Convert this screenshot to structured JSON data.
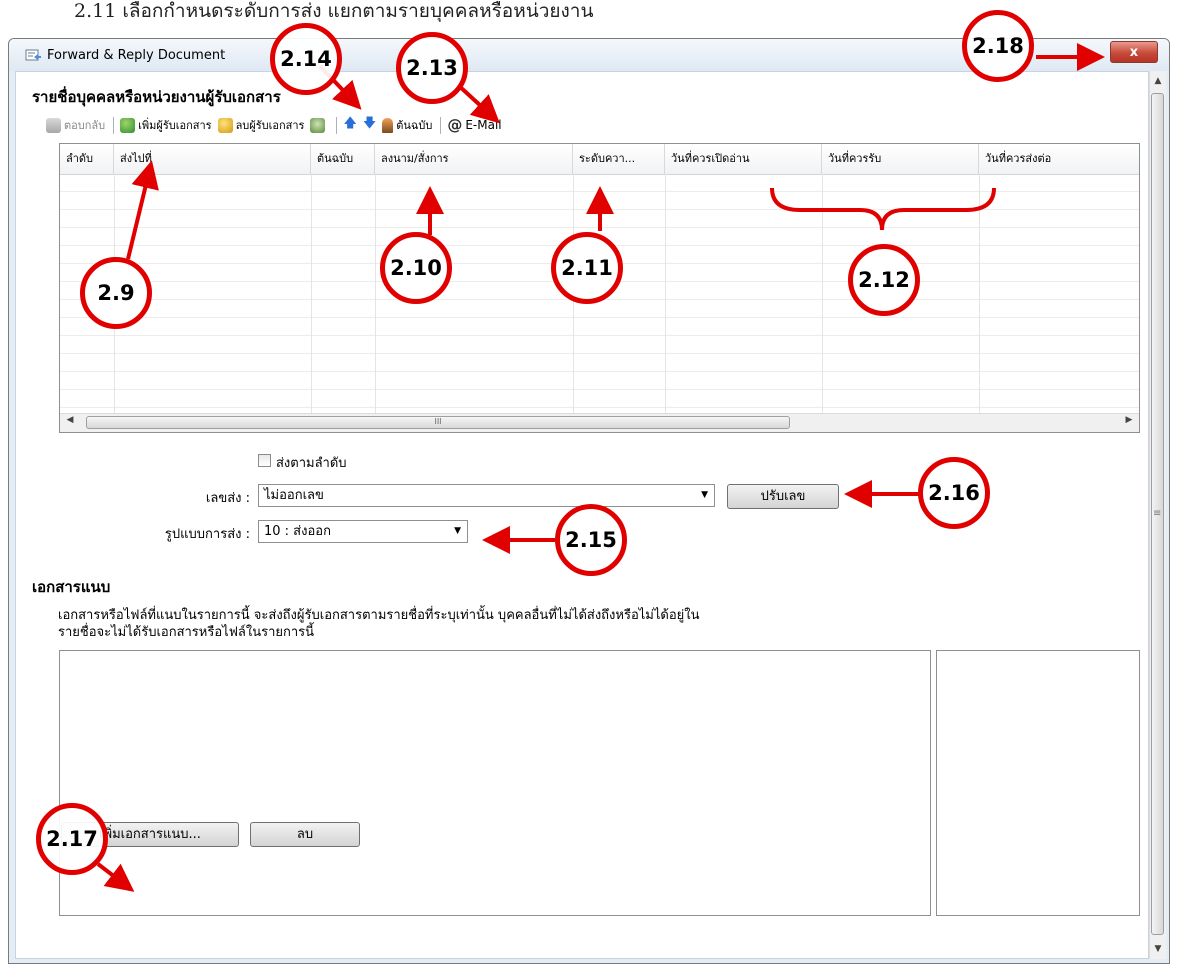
{
  "heading": "2.11  เลือกกำหนดระดับการส่ง แยกตามรายบุคคลหรือหน่วยงาน",
  "window": {
    "title": "Forward & Reply Document",
    "close_label": "x"
  },
  "recipients": {
    "section_title": "รายชื่อบุคคลหรือหน่วยงานผู้รับเอกสาร",
    "toolbar": {
      "reply": "ตอบกลับ",
      "add_recipient": "เพิ่มผู้รับเอกสาร",
      "remove_recipient": "ลบผู้รับเอกสาร",
      "original": "ต้นฉบับ",
      "email": "E-Mail"
    },
    "columns": [
      "ลำดับ",
      "ส่งไปที่",
      "ต้นฉบับ",
      "ลงนาม/สั่งการ",
      "ระดับควา...",
      "วันที่ควรเปิดอ่าน",
      "วันที่ควรรับ",
      "วันที่ควรส่งต่อ"
    ]
  },
  "options": {
    "send_in_order_label": "ส่งตามลำดับ",
    "send_in_order_checked": false,
    "send_number_label": "เลขส่ง :",
    "send_number_value": "ไม่ออกเลข",
    "adjust_number_button": "ปรับเลข",
    "send_format_label": "รูปแบบการส่ง :",
    "send_format_value": "10 : ส่งออก"
  },
  "attachments": {
    "section_title": "เอกสารแนบ",
    "description_line1": "เอกสารหรือไฟล์ที่แนบในรายการนี้ จะส่งถึงผู้รับเอกสารตามรายชื่อที่ระบุเท่านั้น บุคคลอื่นที่ไม่ได้ส่งถึงหรือไม่ได้อยู่ใน",
    "description_line2": "รายชื่อจะไม่ได้รับเอกสารหรือไฟล์ในรายการนี้",
    "add_button": "เพิ่มเอกสารแนบ...",
    "delete_button": "ลบ"
  },
  "annotations": [
    "2.9",
    "2.10",
    "2.11",
    "2.12",
    "2.13",
    "2.14",
    "2.15",
    "2.16",
    "2.17",
    "2.18"
  ],
  "colors": {
    "annotation_red": "#e10000",
    "window_frame": "#e4ecf6",
    "close_button": "#c74a3a"
  }
}
